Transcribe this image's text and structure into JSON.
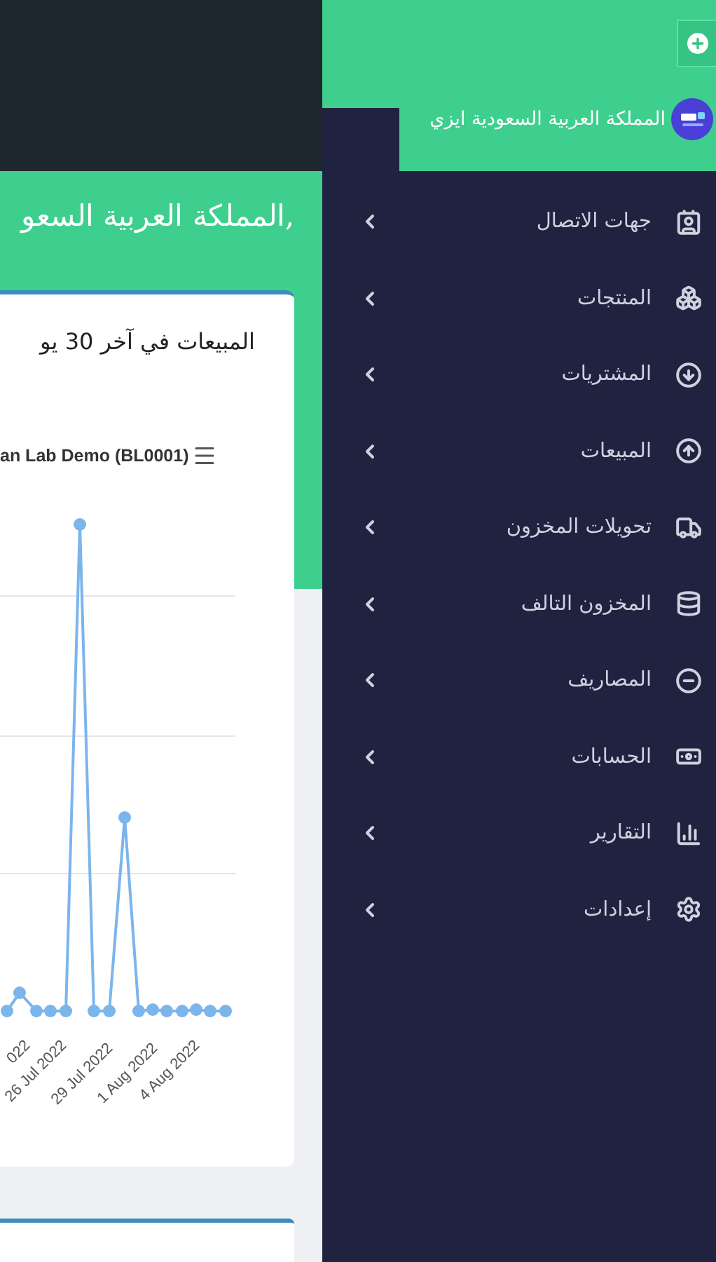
{
  "header": {
    "brand": "المملكة العربية السعودية ايزي"
  },
  "sidebar": {
    "items": [
      {
        "label": "جهات الاتصال"
      },
      {
        "label": "المنتجات"
      },
      {
        "label": "المشتريات"
      },
      {
        "label": "المبيعات"
      },
      {
        "label": "تحويلات المخزون"
      },
      {
        "label": "المخزون التالف"
      },
      {
        "label": "المصاريف"
      },
      {
        "label": "الحسابات"
      },
      {
        "label": "التقارير"
      },
      {
        "label": "إعدادات"
      }
    ]
  },
  "greeting": ",المملكة العربية السعو",
  "sales_card": {
    "title": "المبيعات في آخر 30 يو",
    "chart_title": "an Lab Demo (BL0001)",
    "x_labels": [
      "022",
      "26 Jul 2022",
      "29 Jul 2022",
      "1 Aug 2022",
      "4 Aug 2022"
    ]
  }
}
